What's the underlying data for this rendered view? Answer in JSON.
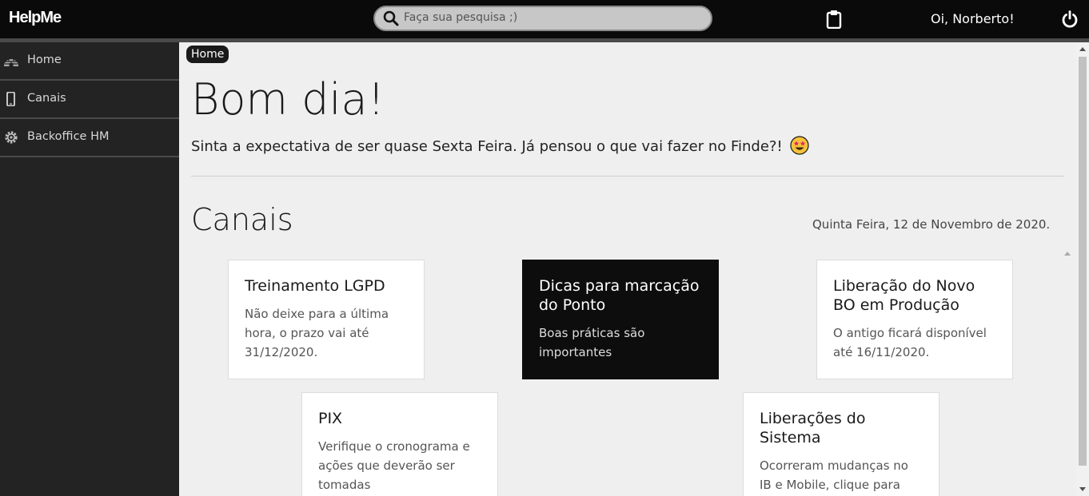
{
  "app": {
    "logo": "HelpMe"
  },
  "header": {
    "search_placeholder": "Faça sua pesquisa ;)",
    "greeting": "Oi, Norberto!",
    "icons": [
      "search-icon",
      "clipboard-icon",
      "power-icon"
    ]
  },
  "sidebar": {
    "items": [
      {
        "label": "Home",
        "icon": "igloo-icon"
      },
      {
        "label": "Canais",
        "icon": "mobile-icon"
      },
      {
        "label": "Backoffice HM",
        "icon": "gear-icon"
      }
    ]
  },
  "main": {
    "breadcrumb": "Home",
    "title": "Bom dia!",
    "subtitle": "Sinta a expectativa de ser quase Sexta Feira. Já pensou o que vai fazer no Finde?!",
    "section_title": "Canais",
    "date": "Quinta Feira, 12 de Novembro de 2020.",
    "cards": [
      {
        "title": "Treinamento LGPD",
        "desc": "Não deixe para a última hora, o prazo vai até 31/12/2020.",
        "highlighted": false
      },
      {
        "title": "Dicas para marcação do Ponto",
        "desc": "Boas práticas são importantes",
        "highlighted": true
      },
      {
        "title": "Liberação do Novo BO em Produção",
        "desc": "O antigo ficará disponível até 16/11/2020.",
        "highlighted": false
      },
      {
        "title": "PIX",
        "desc": "Verifique o cronograma e ações que deverão ser tomadas",
        "highlighted": false
      },
      {
        "title": "Liberações do Sistema",
        "desc": "Ocorreram mudanças no IB e Mobile, clique para",
        "highlighted": false
      }
    ]
  },
  "colors": {
    "topbar": "#0a0a0a",
    "sidebar": "#232323",
    "highlight_card": "#0d0d0d",
    "background": "#efefef"
  }
}
